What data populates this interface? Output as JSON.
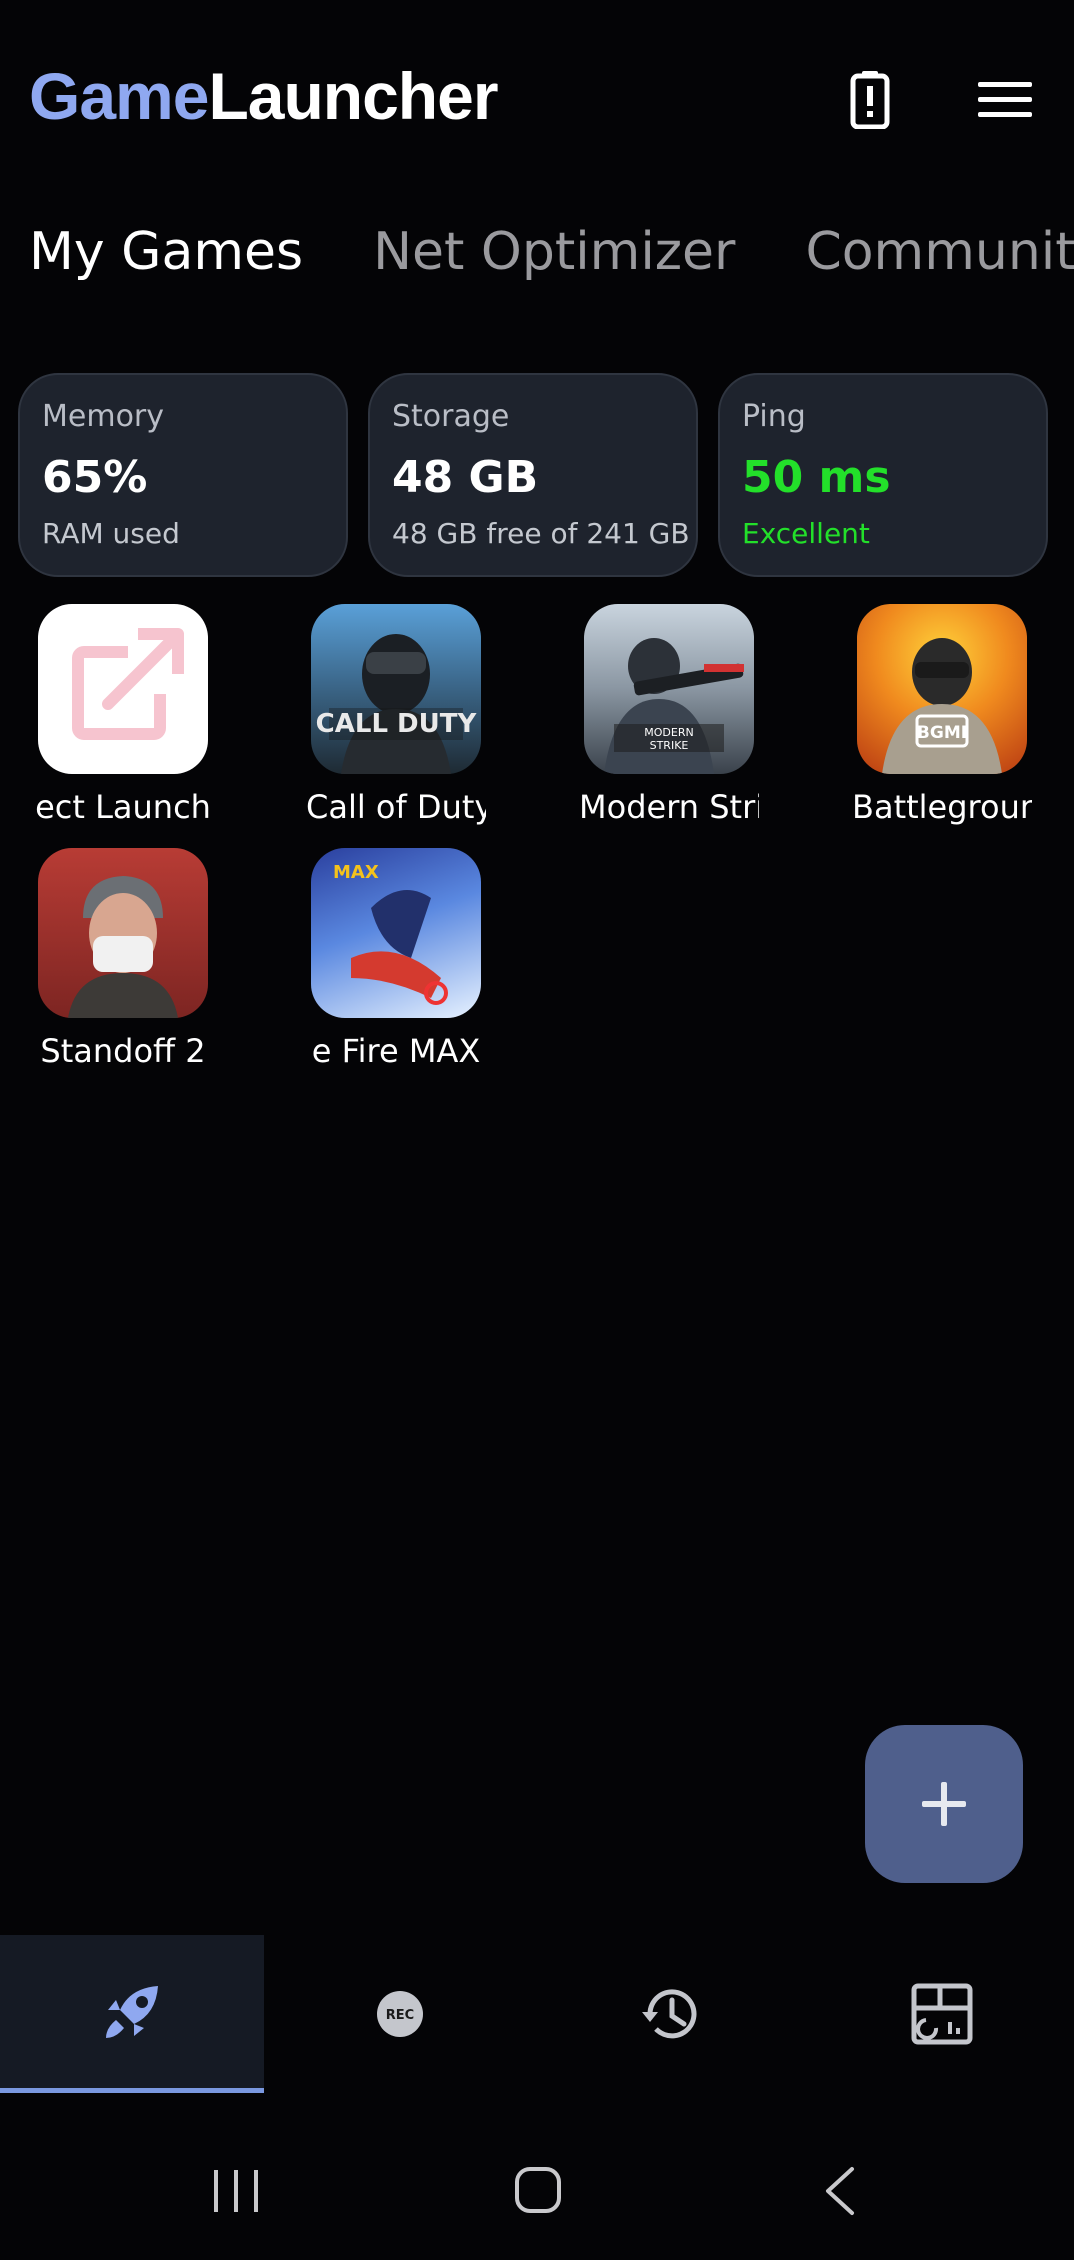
{
  "header": {
    "brand_part1": "Game",
    "brand_part2": "Launcher",
    "icons": [
      "battery-alert-icon",
      "hamburger-menu-icon"
    ]
  },
  "tabs": [
    {
      "label": "My Games",
      "active": true
    },
    {
      "label": "Net Optimizer",
      "active": false
    },
    {
      "label": "Community",
      "active": false
    }
  ],
  "stats": {
    "memory": {
      "label": "Memory",
      "value": "65%",
      "sub": "RAM used"
    },
    "storage": {
      "label": "Storage",
      "value": "48 GB",
      "sub": "48 GB free of 241 GB"
    },
    "ping": {
      "label": "Ping",
      "value": "50 ms",
      "sub": "Excellent",
      "accent": "#23e02a"
    }
  },
  "games": [
    {
      "name": "ect Launch",
      "icon": "external-launch-icon"
    },
    {
      "name": "Call of Duty",
      "icon": "call-of-duty-icon"
    },
    {
      "name": "Modern Stri",
      "icon": "modern-strike-icon"
    },
    {
      "name": "Battlegroun",
      "icon": "battlegrounds-icon"
    },
    {
      "name": "Standoff 2",
      "icon": "standoff-2-icon"
    },
    {
      "name": "e Fire MAX",
      "icon": "free-fire-max-icon"
    }
  ],
  "fab": {
    "icon": "plus-icon"
  },
  "bottom_nav": [
    {
      "icon": "rocket-icon",
      "active": true
    },
    {
      "icon": "rec-icon",
      "active": false
    },
    {
      "icon": "history-icon",
      "active": false
    },
    {
      "icon": "dashboard-icon",
      "active": false
    }
  ],
  "system_nav": [
    "recents-icon",
    "home-icon",
    "back-icon"
  ],
  "colors": {
    "background": "#040406",
    "brand_accent": "#8fa8f0",
    "card_bg": "#1e232d",
    "fab_bg": "#4f5f8c",
    "nav_active_indicator": "#7a98e0"
  }
}
